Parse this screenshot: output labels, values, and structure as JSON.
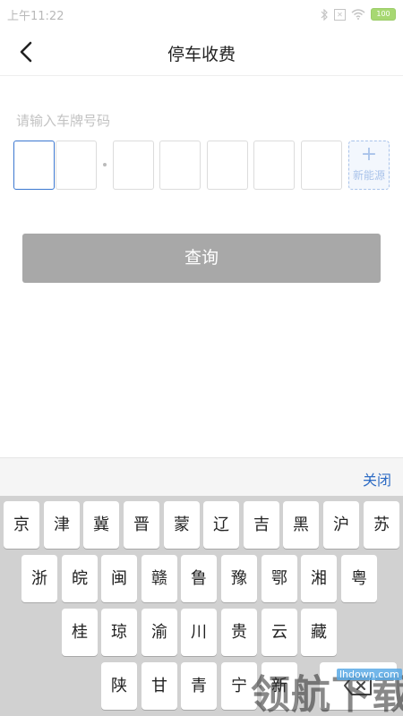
{
  "status_bar": {
    "time": "上午11:22",
    "battery": "100",
    "sim_label": "✕"
  },
  "header": {
    "title": "停车收费"
  },
  "plate": {
    "label": "请输入车牌号码",
    "new_energy_label": "新能源",
    "plus": "+"
  },
  "query_button": {
    "label": "查询"
  },
  "keyboard": {
    "close_label": "关闭",
    "rows": [
      [
        "京",
        "津",
        "冀",
        "晋",
        "蒙",
        "辽",
        "吉",
        "黑",
        "沪",
        "苏"
      ],
      [
        "浙",
        "皖",
        "闽",
        "赣",
        "鲁",
        "豫",
        "鄂",
        "湘",
        "粤"
      ],
      [
        "桂",
        "琼",
        "渝",
        "川",
        "贵",
        "云",
        "藏"
      ],
      [
        "陕",
        "甘",
        "青",
        "宁",
        "新"
      ]
    ]
  },
  "watermark": {
    "text": "领航下载",
    "url": "lhdown.com"
  }
}
